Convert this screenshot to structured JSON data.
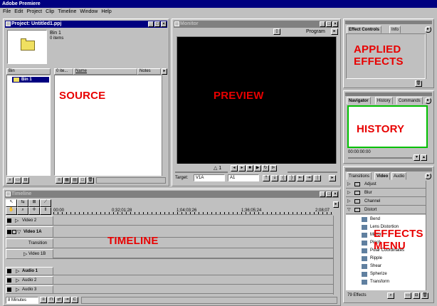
{
  "app": {
    "title": "Adobe Premiere"
  },
  "menu": [
    "File",
    "Edit",
    "Project",
    "Clip",
    "Timeline",
    "Window",
    "Help"
  ],
  "project": {
    "title": "Project: Untitled1.ppj",
    "bin_name": "Bin 1",
    "bin_items": "0 items",
    "columns": {
      "bin": "Bin",
      "count": "0 ite...",
      "name": "Name",
      "notes": "Notes"
    },
    "bins": [
      {
        "label": "Bin 1"
      }
    ],
    "annotation": "SOURCE"
  },
  "monitor": {
    "title": "Monitor",
    "view_label": "Program",
    "annotation": "PREVIEW",
    "timecode": "△ 1",
    "target_label": "Target:",
    "target_video": "V1A",
    "target_audio": "A1"
  },
  "effect_controls": {
    "tabs": [
      "Effect Controls",
      "Info"
    ],
    "annotation_line1": "APPLIED",
    "annotation_line2": "EFFECTS"
  },
  "navigator": {
    "tabs": [
      "Navigator",
      "History",
      "Commands"
    ],
    "annotation": "HISTORY",
    "timecode": "00:00:00:00"
  },
  "effects": {
    "tabs": [
      "Transitions",
      "Video",
      "Audio"
    ],
    "folders": [
      "Adjust",
      "Blur",
      "Channel",
      "Distort"
    ],
    "items": [
      "Bend",
      "Lens Distortion",
      "Mirror",
      "Pinch",
      "Polar Coordinates",
      "Ripple",
      "Shear",
      "Spherize",
      "Transform"
    ],
    "count_label": "79 Effects",
    "annotation_line1": "EFFECTS",
    "annotation_line2": "MENU"
  },
  "timeline": {
    "title": "Timeline",
    "ruler": [
      "00:00",
      "0;32;01;28",
      "1;04;03;26",
      "1;36;05;24",
      "2;08;07"
    ],
    "tracks": [
      {
        "label": "Video 2",
        "type": "video"
      },
      {
        "label": "Video 1A",
        "type": "video-bold"
      },
      {
        "label": "Transition",
        "type": "transition"
      },
      {
        "label": "Video 1B",
        "type": "video"
      },
      {
        "label": "Audio 1",
        "type": "audio-bold"
      },
      {
        "label": "Audio 2",
        "type": "audio"
      },
      {
        "label": "Audio 3",
        "type": "audio"
      }
    ],
    "zoom_label": "8 Minutes",
    "annotation": "TIMELINE"
  }
}
